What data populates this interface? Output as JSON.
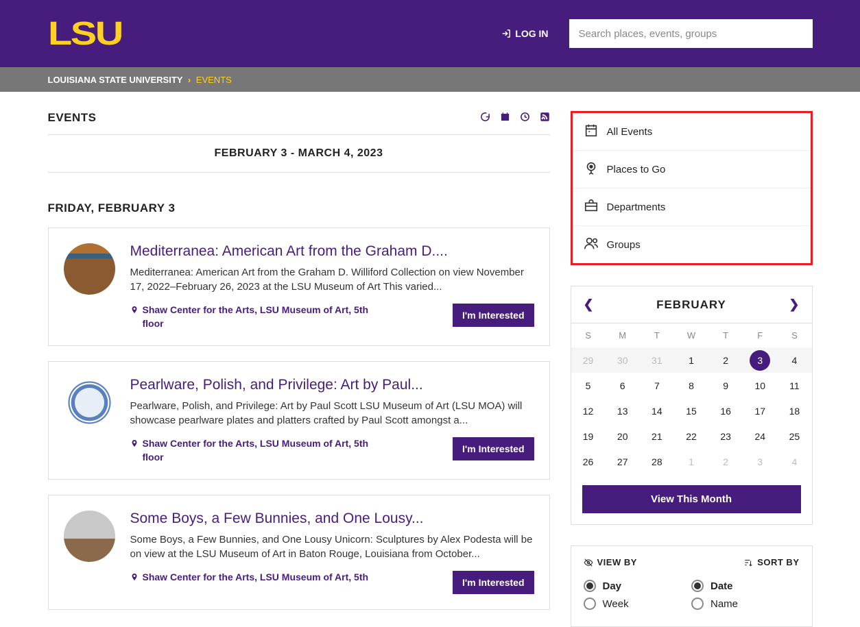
{
  "header": {
    "logo": "LSU",
    "login_label": "LOG IN",
    "search_placeholder": "Search places, events, groups"
  },
  "breadcrumb": {
    "root": "LOUISIANA STATE UNIVERSITY",
    "current": "EVENTS"
  },
  "page": {
    "title": "EVENTS",
    "date_range": "FEBRUARY 3 - MARCH 4, 2023",
    "day_header": "FRIDAY, FEBRUARY 3"
  },
  "feed_icons": [
    "google-icon",
    "calendar-icon",
    "clock-icon",
    "rss-icon"
  ],
  "events": [
    {
      "title": "Mediterranea: American Art from the Graham D....",
      "desc": "Mediterranea: American Art from the Graham D. Williford Collection on view November 17, 2022–February 26, 2023 at the LSU Museum of Art This varied...",
      "location": "Shaw Center for the Arts, LSU Museum of Art, 5th floor",
      "button": "I'm Interested"
    },
    {
      "title": "Pearlware, Polish, and Privilege: Art by Paul...",
      "desc": "Pearlware, Polish, and Privilege: Art by Paul Scott LSU Museum of Art (LSU MOA) will showcase pearlware plates and platters crafted by Paul Scott amongst a...",
      "location": "Shaw Center for the Arts, LSU Museum of Art, 5th floor",
      "button": "I'm Interested"
    },
    {
      "title": "Some Boys, a Few Bunnies, and One Lousy...",
      "desc": "Some Boys, a Few Bunnies, and One Lousy Unicorn: Sculptures by Alex Podesta will be on view at the LSU Museum of Art in Baton Rouge, Louisiana from October...",
      "location": "Shaw Center for the Arts, LSU Museum of Art, 5th",
      "button": "I'm Interested"
    }
  ],
  "sidebar": {
    "nav": [
      {
        "label": "All Events"
      },
      {
        "label": "Places to Go"
      },
      {
        "label": "Departments"
      },
      {
        "label": "Groups"
      }
    ],
    "calendar": {
      "month": "FEBRUARY",
      "dow": [
        "S",
        "M",
        "T",
        "W",
        "T",
        "F",
        "S"
      ],
      "weeks": [
        [
          {
            "n": "29",
            "out": true
          },
          {
            "n": "30",
            "out": true
          },
          {
            "n": "31",
            "out": true
          },
          {
            "n": "1"
          },
          {
            "n": "2"
          },
          {
            "n": "3",
            "selected": true
          },
          {
            "n": "4"
          }
        ],
        [
          {
            "n": "5"
          },
          {
            "n": "6"
          },
          {
            "n": "7"
          },
          {
            "n": "8"
          },
          {
            "n": "9"
          },
          {
            "n": "10"
          },
          {
            "n": "11"
          }
        ],
        [
          {
            "n": "12"
          },
          {
            "n": "13"
          },
          {
            "n": "14"
          },
          {
            "n": "15"
          },
          {
            "n": "16"
          },
          {
            "n": "17"
          },
          {
            "n": "18"
          }
        ],
        [
          {
            "n": "19"
          },
          {
            "n": "20"
          },
          {
            "n": "21"
          },
          {
            "n": "22"
          },
          {
            "n": "23"
          },
          {
            "n": "24"
          },
          {
            "n": "25"
          }
        ],
        [
          {
            "n": "26"
          },
          {
            "n": "27"
          },
          {
            "n": "28"
          },
          {
            "n": "1",
            "out": true
          },
          {
            "n": "2",
            "out": true
          },
          {
            "n": "3",
            "out": true
          },
          {
            "n": "4",
            "out": true
          }
        ]
      ],
      "view_month": "View This Month"
    },
    "filters": {
      "view_by": "VIEW BY",
      "sort_by": "SORT BY",
      "view_options": [
        {
          "label": "Day",
          "checked": true
        },
        {
          "label": "Week",
          "checked": false
        }
      ],
      "sort_options": [
        {
          "label": "Date",
          "checked": true
        },
        {
          "label": "Name",
          "checked": false
        }
      ]
    }
  }
}
